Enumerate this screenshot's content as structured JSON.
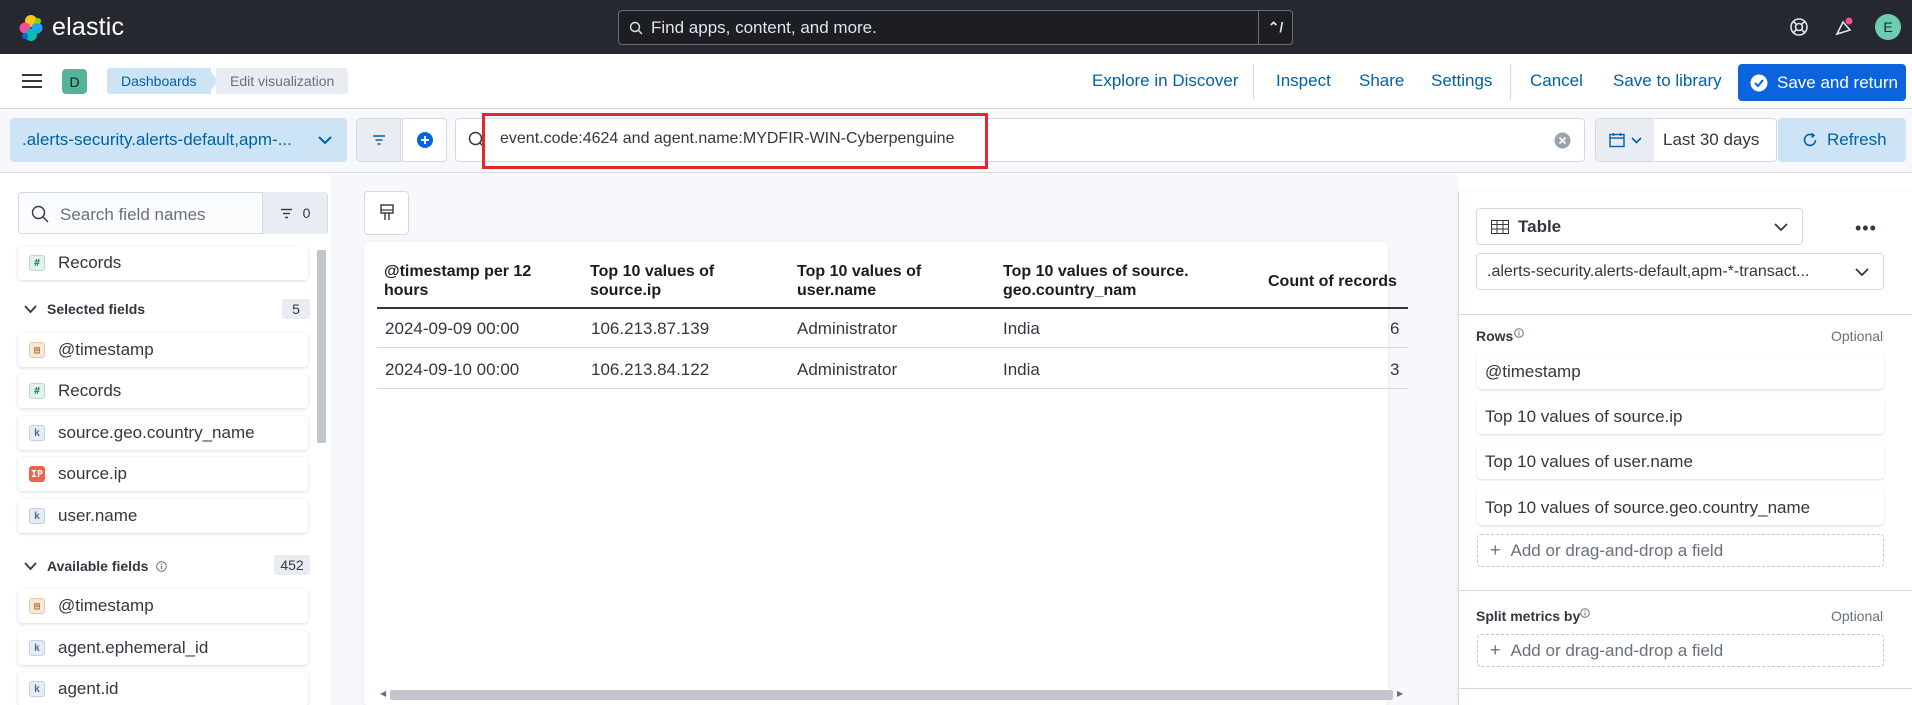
{
  "topbar": {
    "brand": "elastic",
    "search_placeholder": "Find apps, content, and more.",
    "search_shortcut": "⌃/",
    "user_initial": "E"
  },
  "subbar": {
    "space_initial": "D",
    "breadcrumbs": [
      "Dashboards",
      "Edit visualization"
    ],
    "links": {
      "explore": "Explore in Discover",
      "inspect": "Inspect",
      "share": "Share",
      "settings": "Settings",
      "cancel": "Cancel",
      "save_library": "Save to library"
    },
    "save_return": "Save and return"
  },
  "querybar": {
    "dataview": ".alerts-security.alerts-default,apm-...",
    "query": "event.code:4624 and agent.name:MYDFIR-WIN-Cyberpenguine",
    "date_range": "Last 30 days",
    "refresh": "Refresh"
  },
  "fields": {
    "search_placeholder": "Search field names",
    "filter_count": "0",
    "top_item": "Records",
    "selected_label": "Selected fields",
    "selected_count": "5",
    "selected": [
      "@timestamp",
      "Records",
      "source.geo.country_name",
      "source.ip",
      "user.name"
    ],
    "available_label": "Available fields",
    "available_count": "452",
    "available": [
      "@timestamp",
      "agent.ephemeral_id",
      "agent.id"
    ]
  },
  "table": {
    "headers": [
      "@timestamp per 12 hours",
      "Top 10 values of source.ip",
      "Top 10 values of user.name",
      "Top 10 values of source.geo.country_nam",
      "Count of records"
    ],
    "rows": [
      [
        "2024-09-09 00:00",
        "106.213.87.139",
        "Administrator",
        "India",
        "6"
      ],
      [
        "2024-09-10 00:00",
        "106.213.84.122",
        "Administrator",
        "India",
        "3"
      ]
    ]
  },
  "config": {
    "vis_type": "Table",
    "dataview": ".alerts-security.alerts-default,apm-*-transact...",
    "rows_label": "Rows",
    "optional": "Optional",
    "rows": [
      "@timestamp",
      "Top 10 values of source.ip",
      "Top 10 values of user.name",
      "Top 10 values of source.geo.country_name"
    ],
    "add_field": "Add or drag-and-drop a field",
    "split_label": "Split metrics by"
  }
}
